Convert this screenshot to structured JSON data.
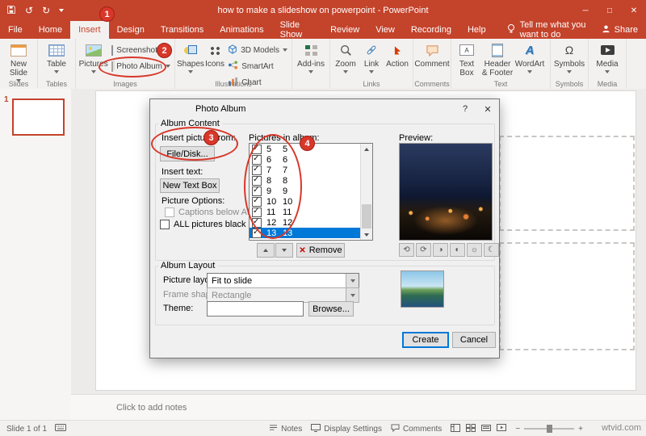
{
  "colors": {
    "accent": "#C4432B",
    "selection": "#0078D7",
    "annotation": "#D8372A"
  },
  "titlebar": {
    "title": "how to make a slideshow on powerpoint  -  PowerPoint",
    "minimize": "─",
    "maximize": "□",
    "close": "✕"
  },
  "tabs": {
    "file": "File",
    "home": "Home",
    "insert": "Insert",
    "design": "Design",
    "transitions": "Transitions",
    "animations": "Animations",
    "slide_show": "Slide Show",
    "review": "Review",
    "view": "View",
    "recording": "Recording",
    "help": "Help",
    "tell_me": "Tell me what you want to do",
    "share": "Share"
  },
  "ribbon": {
    "new_slide": "New Slide",
    "table": "Table",
    "pictures": "Pictures",
    "screenshot": "Screenshot",
    "photo_album": "Photo Album",
    "shapes": "Shapes",
    "icons": "Icons",
    "models_3d": "3D Models",
    "smartart": "SmartArt",
    "chart": "Chart",
    "add_ins": "Add-ins",
    "zoom": "Zoom",
    "link": "Link",
    "action": "Action",
    "comment": "Comment",
    "text_box": "Text Box",
    "header_footer": "Header & Footer",
    "wordart": "WordArt",
    "symbols": "Symbols",
    "media": "Media",
    "group_labels": {
      "slides": "Slides",
      "tables": "Tables",
      "images": "Images",
      "illustrations": "Illustrations",
      "links": "Links",
      "comments": "Comments",
      "text": "Text",
      "symbols": "Symbols",
      "media": "Media"
    }
  },
  "annotations": {
    "step1": "1",
    "step2": "2",
    "step3": "3",
    "step4": "4"
  },
  "slide_panel": {
    "number": "1"
  },
  "dialog": {
    "title": "Photo Album",
    "help": "?",
    "close": "✕",
    "album_content": "Album Content",
    "insert_picture_from": "Insert picture from:",
    "file_disk_button": "File/Disk...",
    "insert_text": "Insert text:",
    "new_text_box_button": "New Text Box",
    "picture_options": "Picture Options:",
    "captions_option": "Captions below ALL pictures",
    "black_white_option": "ALL pictures black and white",
    "pictures_in_album": "Pictures in album:",
    "pictures": [
      {
        "num": "5",
        "name": "5",
        "checked": true
      },
      {
        "num": "6",
        "name": "6",
        "checked": true
      },
      {
        "num": "7",
        "name": "7",
        "checked": true
      },
      {
        "num": "8",
        "name": "8",
        "checked": true
      },
      {
        "num": "9",
        "name": "9",
        "checked": true
      },
      {
        "num": "10",
        "name": "10",
        "checked": true
      },
      {
        "num": "11",
        "name": "11",
        "checked": true
      },
      {
        "num": "12",
        "name": "12",
        "checked": true
      },
      {
        "num": "13",
        "name": "13",
        "checked": true,
        "selected": true
      }
    ],
    "preview_label": "Preview:",
    "remove_button": "Remove",
    "album_layout": "Album Layout",
    "picture_layout_label": "Picture layout:",
    "picture_layout_value": "Fit to slide",
    "frame_shape_label": "Frame shape:",
    "frame_shape_value": "Rectangle",
    "theme_label": "Theme:",
    "browse_button": "Browse...",
    "create_button": "Create",
    "cancel_button": "Cancel"
  },
  "notes": {
    "placeholder": "Click to add notes"
  },
  "statusbar": {
    "slide_count": "Slide 1 of 1",
    "notes": "Notes",
    "display_settings": "Display Settings",
    "comments": "Comments",
    "watermark": "wtvid.com"
  }
}
